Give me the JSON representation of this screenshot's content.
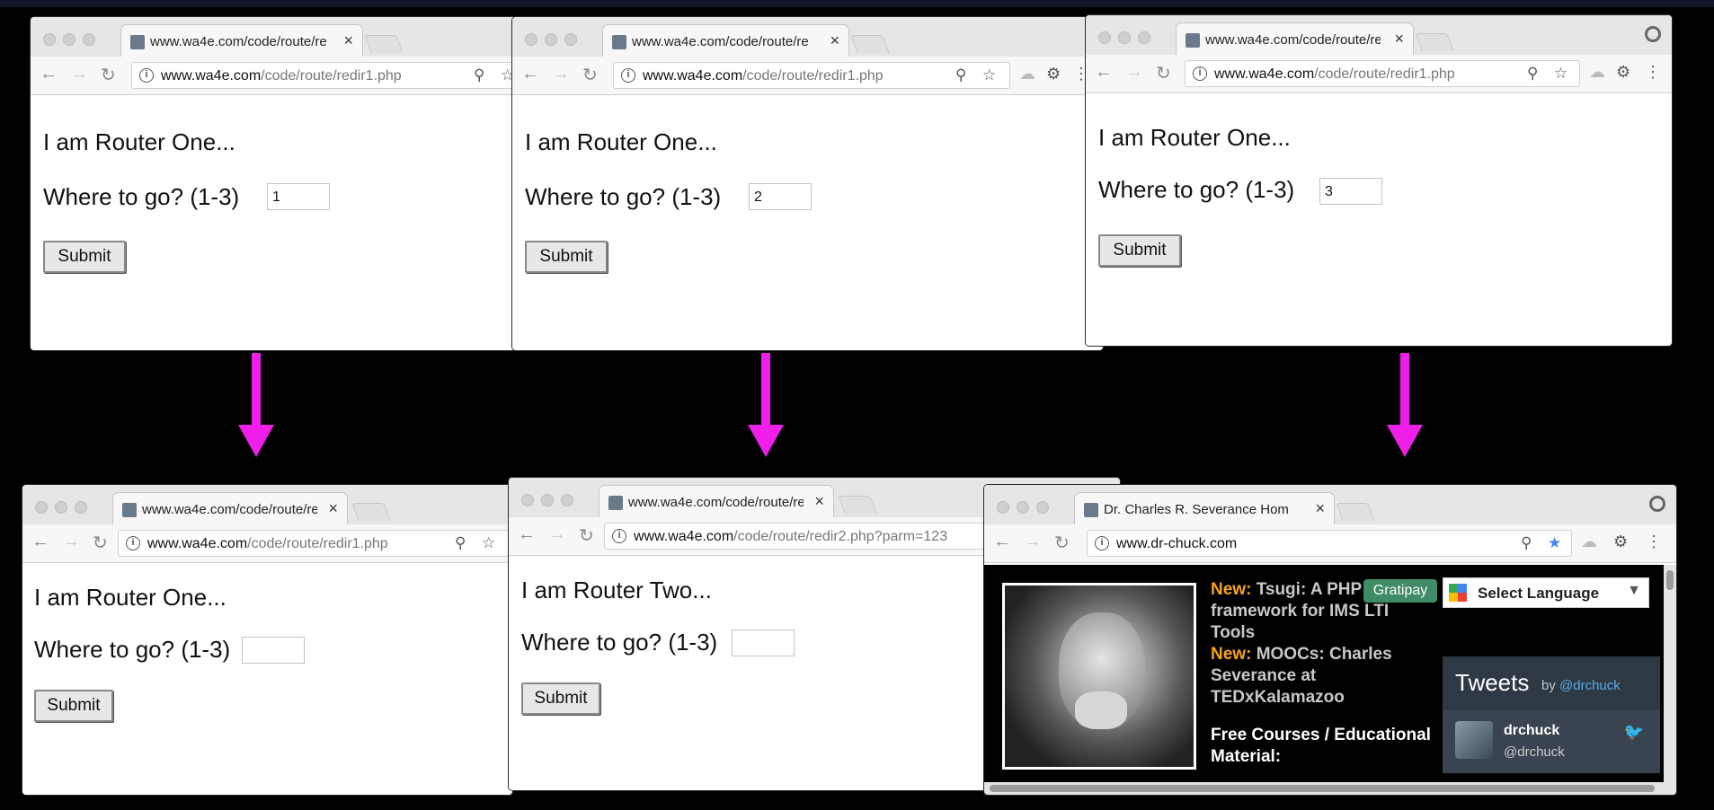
{
  "windows": [
    {
      "tab_title": "www.wa4e.com/code/route/re",
      "url_host": "www.wa4e.com",
      "url_path": "/code/route/redir1.php",
      "heading": "I am Router One...",
      "prompt": "Where to go? (1-3)",
      "input_value": "1",
      "submit_label": "Submit"
    },
    {
      "tab_title": "www.wa4e.com/code/route/re",
      "url_host": "www.wa4e.com",
      "url_path": "/code/route/redir1.php",
      "heading": "I am Router One...",
      "prompt": "Where to go? (1-3)",
      "input_value": "2",
      "submit_label": "Submit"
    },
    {
      "tab_title": "www.wa4e.com/code/route/re",
      "url_host": "www.wa4e.com",
      "url_path": "/code/route/redir1.php",
      "heading": "I am Router One...",
      "prompt": "Where to go? (1-3)",
      "input_value": "3",
      "submit_label": "Submit"
    },
    {
      "tab_title": "www.wa4e.com/code/route/re",
      "url_host": "www.wa4e.com",
      "url_path": "/code/route/redir1.php",
      "heading": "I am Router One...",
      "prompt": "Where to go? (1-3)",
      "input_value": "",
      "submit_label": "Submit"
    },
    {
      "tab_title": "www.wa4e.com/code/route/re",
      "url_host": "www.wa4e.com",
      "url_path": "/code/route/redir2.php?parm=123",
      "heading": "I am Router Two...",
      "prompt": "Where to go? (1-3)",
      "input_value": "",
      "submit_label": "Submit"
    },
    {
      "tab_title": "Dr. Charles R. Severance Hom",
      "url_host": "www.dr-chuck.com",
      "url_path": "",
      "news": [
        {
          "badge": "New:",
          "text": "Tsugi: A PHP framework for IMS LTI Tools"
        },
        {
          "badge": "New:",
          "text": "MOOCs: Charles Severance at TEDxKalamazoo"
        }
      ],
      "courses_title": "Free Courses / Educational Material:",
      "gratipay_label": "Gratipay",
      "select_language_label": "Select Language",
      "tweets_title": "Tweets",
      "tweets_by": "by",
      "tweets_handle": "@drchuck",
      "tweet_name": "drchuck",
      "tweet_handle": "@drchuck"
    }
  ],
  "icons": {
    "back": "←",
    "forward": "→",
    "reload": "↻",
    "info": "i",
    "zoom": "⚲",
    "star": "☆",
    "star_filled": "★",
    "cloud": "☁",
    "gear": "⚙",
    "menu": "⋮",
    "close": "×",
    "caret": "▼",
    "bird": "🐦"
  },
  "colors": {
    "arrow": "#ee1fe8",
    "new_badge": "#f5a31a",
    "gratipay": "#3f8b66",
    "twitter_link": "#55acee",
    "star_active": "#4285f4"
  }
}
